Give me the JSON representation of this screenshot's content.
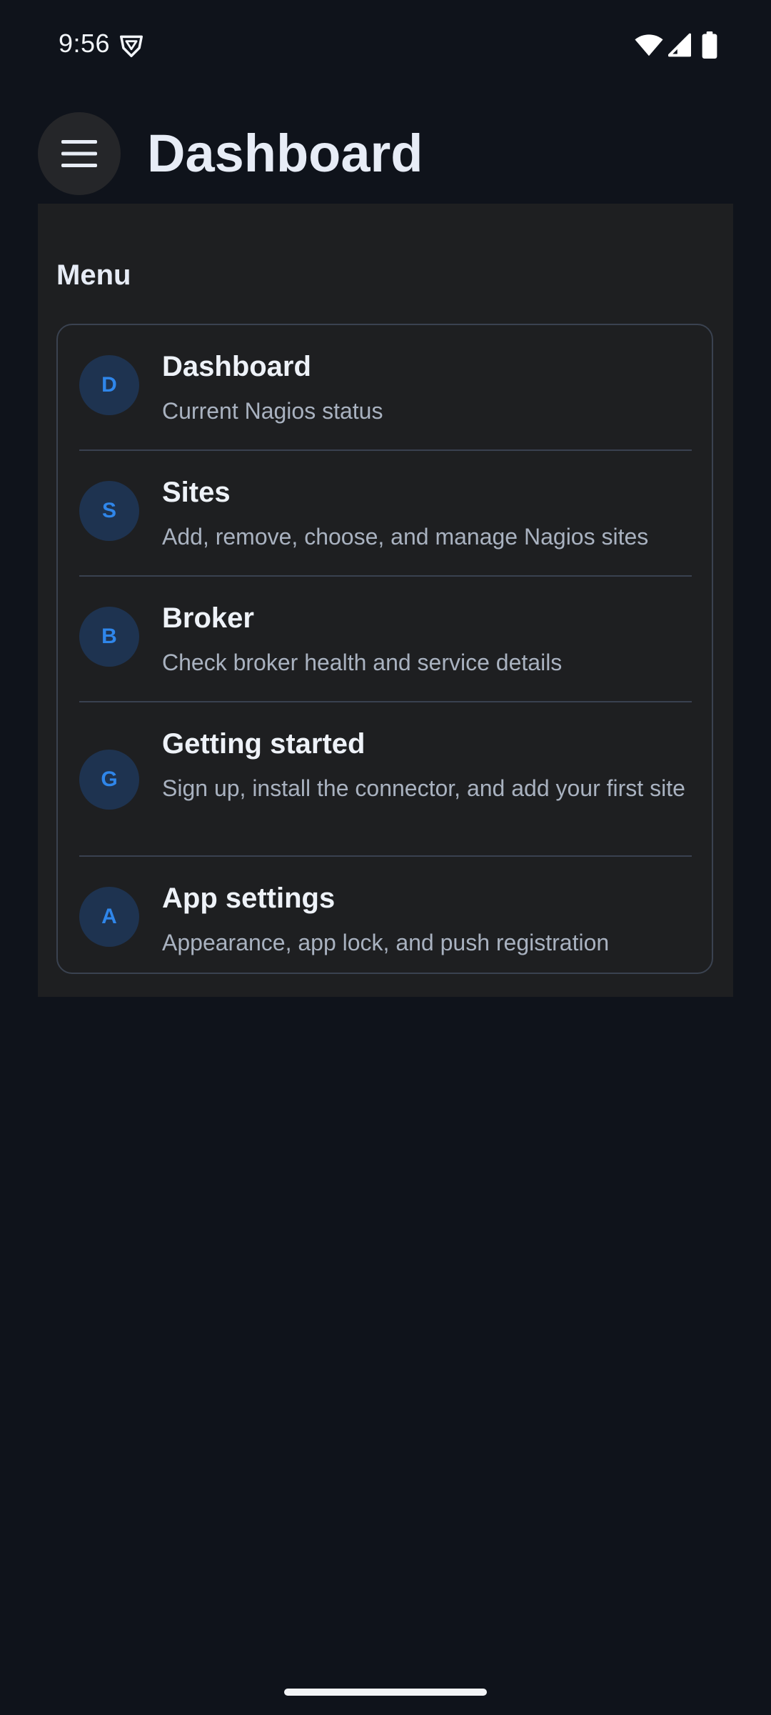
{
  "status_bar": {
    "time": "9:56",
    "icons": [
      "shield-icon",
      "wifi-icon",
      "cell-signal-icon",
      "battery-icon"
    ]
  },
  "header": {
    "menu_icon": "hamburger-menu-icon",
    "title": "Dashboard"
  },
  "panel": {
    "heading": "Menu",
    "items": [
      {
        "letter": "D",
        "title": "Dashboard",
        "subtitle": "Current Nagios status"
      },
      {
        "letter": "S",
        "title": "Sites",
        "subtitle": "Add, remove, choose, and manage Nagios sites"
      },
      {
        "letter": "B",
        "title": "Broker",
        "subtitle": "Check broker health and service details"
      },
      {
        "letter": "G",
        "title": "Getting started",
        "subtitle": "Sign up, install the connector, and add your first site"
      },
      {
        "letter": "A",
        "title": "App settings",
        "subtitle": "Appearance, app lock, and push registration"
      }
    ]
  },
  "colors": {
    "background": "#0f131b",
    "panel": "#1e1f21",
    "accent": "#2f86ea",
    "avatar_bg": "#1e3350"
  }
}
